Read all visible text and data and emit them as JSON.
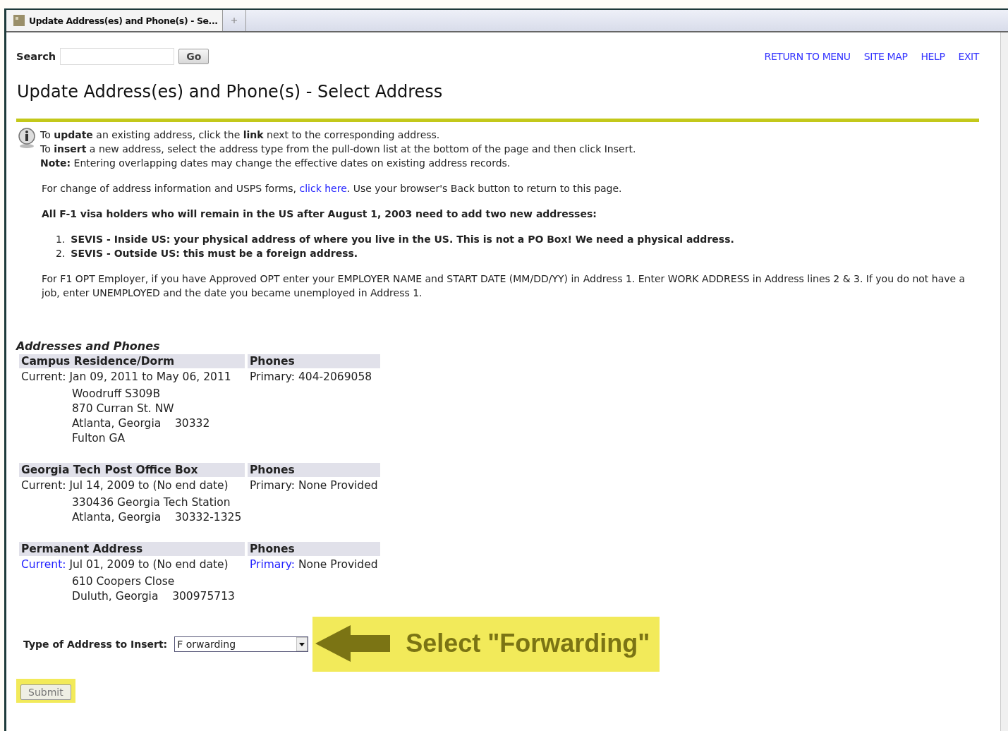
{
  "browser": {
    "tabs": [
      {
        "title": "Update Address(es) and Phone(s) - Se...",
        "selected": true
      }
    ]
  },
  "search": {
    "label": "Search",
    "button": "Go"
  },
  "nav_links": [
    "RETURN TO MENU",
    "SITE MAP",
    "HELP",
    "EXIT"
  ],
  "page_title": "Update Address(es) and Phone(s) - Select Address",
  "info_lines": [
    "To **update** an existing address, click the **link** next to the corresponding address.",
    "To **insert** a new address, select the address type from the pull-down list at the bottom of the page and then click Insert.",
    "**Note:** Entering overlapping dates may change the effective dates on existing address records."
  ],
  "usps_note": {
    "before": "For change of address information and USPS forms,",
    "link": "click here",
    "after": ". Use your browser's Back button to return to this page."
  },
  "f1_heading": "All F-1 visa holders who will remain in the US after August 1, 2003 need to add two new addresses:",
  "sevis_list": [
    {
      "number": "1.",
      "text": "SEVIS - Inside US: your physical address of where you live in the US. This is not a PO Box! We need a physical address."
    },
    {
      "number": "2.",
      "text": "SEVIS - Outside US: this must be a foreign address."
    }
  ],
  "opt_note": "For F1 OPT Employer, if you have Approved OPT enter your EMPLOYER NAME and START DATE (MM/DD/YY) in Address 1. Enter WORK ADDRESS in Address lines 2 & 3. If you do not have a job, enter UNEMPLOYED and the date you became unemployed in Address 1.",
  "addresses": {
    "title": "Addresses and Phones",
    "items": [
      {
        "type": "Campus Residence/Dorm",
        "phones_header": "Phones",
        "current_label": "Current:",
        "current_is_link": false,
        "dates": "Jan 09, 2011 to May 06, 2011",
        "phone_label": "Primary:",
        "phone_is_link": false,
        "phone": "404-2069058",
        "lines": [
          "Woodruff S309B",
          "870 Curran St. NW",
          "Atlanta, Georgia    30332",
          "Fulton GA"
        ]
      },
      {
        "type": "Georgia Tech Post Office Box",
        "phones_header": "Phones",
        "current_label": "Current:",
        "current_is_link": false,
        "dates": "Jul 14, 2009 to (No end date)",
        "phone_label": "Primary:",
        "phone_is_link": false,
        "phone": "None Provided",
        "lines": [
          "330436 Georgia Tech Station",
          "Atlanta, Georgia    30332-1325"
        ]
      },
      {
        "type": "Permanent Address",
        "phones_header": "Phones",
        "current_label": "Current:",
        "current_is_link": true,
        "dates": "Jul 01, 2009 to (No end date)",
        "phone_label": "Primary:",
        "phone_is_link": true,
        "phone": "None Provided",
        "lines": [
          "610 Coopers Close",
          "Duluth, Georgia    300975713"
        ]
      }
    ]
  },
  "insert": {
    "label": "Type of Address to Insert:",
    "value": "F orwarding",
    "button": "Submit",
    "callout": "Select \"Forwarding\""
  }
}
